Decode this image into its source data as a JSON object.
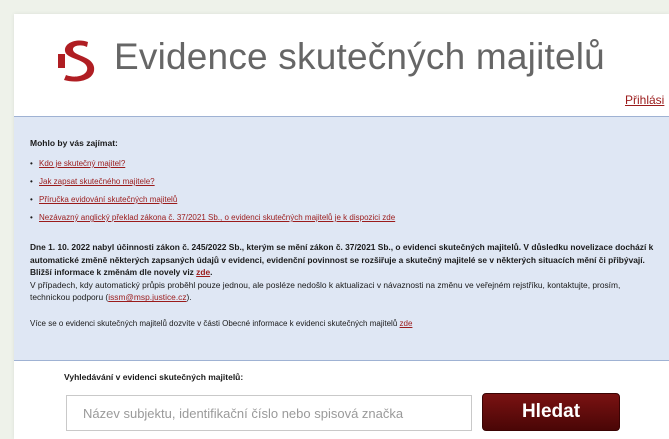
{
  "header": {
    "title": "Evidence skutečných majitelů",
    "login_link": "Přihlási",
    "logo_color": "#b01e23"
  },
  "info": {
    "heading": "Mohlo by vás zajímat:",
    "links": [
      "Kdo je skutečný majitel?",
      "Jak zapsat skutečného majitele?",
      "Příručka evidování skutečných majitelů",
      "Nezávazný anglický překlad zákona č. 37/2021 Sb., o evidenci skutečných majitelů je k dispozici zde"
    ],
    "notice_bold": "Dne 1. 10. 2022 nabyl účinnosti zákon č. 245/2022 Sb., kterým se mění zákon č. 37/2021 Sb., o evidenci skutečných majitelů. V důsledku novelizace dochází k automatické změně některých zapsaných údajů v evidenci, evidenční povinnost se rozšiřuje a skutečný majitelé se v některých situacích mění či přibývají. Bližší informace k změnám dle novely viz ",
    "notice_bold_link": "zde",
    "notice_bold_end": ".",
    "notice_normal": "V případech, kdy automatický průpis proběhl pouze jednou, ale posléze nedošlo k aktualizaci v návaznosti na změnu ve veřejném rejstříku, kontaktujte, prosím, technickou podporu (",
    "notice_email": "issm@msp.justice.cz",
    "notice_normal_end": ").",
    "more_text": "Více se o evidenci skutečných majitelů dozvíte v části Obecné informace k evidenci skutečných majitelů ",
    "more_link": "zde"
  },
  "search": {
    "label": "Vyhledávání v evidenci skutečných majitelů:",
    "placeholder": "Název subjektu, identifikační číslo nebo spisová značka",
    "value": "",
    "button_label": "Hledat"
  }
}
